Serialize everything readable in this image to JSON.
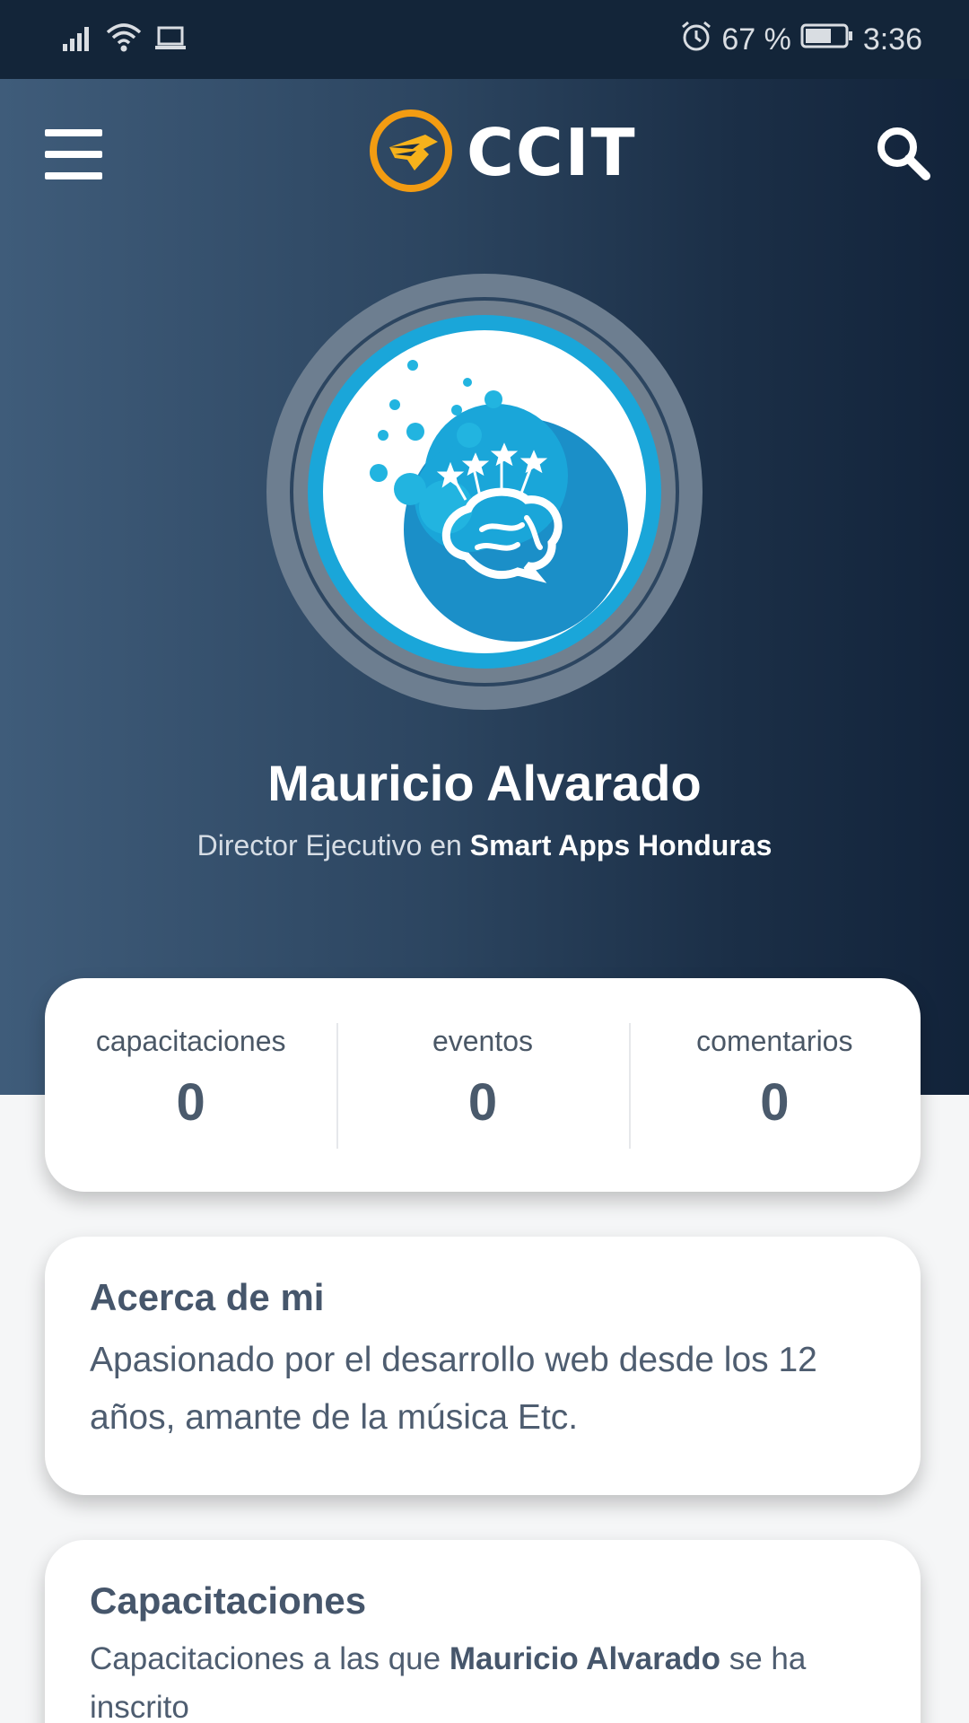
{
  "status_bar": {
    "battery_percent": "67 %",
    "battery_level": 0.67,
    "time": "3:36",
    "icons": [
      "signal-icon",
      "wifi-icon",
      "laptop-icon",
      "alarm-icon",
      "battery-icon"
    ]
  },
  "header": {
    "brand": "CCIT",
    "icons": [
      "menu-icon",
      "logo-icon",
      "search-icon"
    ]
  },
  "profile": {
    "name": "Mauricio Alvarado",
    "role_prefix": "Director Ejecutivo en",
    "company": "Smart Apps Honduras"
  },
  "stats": [
    {
      "label": "capacitaciones",
      "value": "0"
    },
    {
      "label": "eventos",
      "value": "0"
    },
    {
      "label": "comentarios",
      "value": "0"
    }
  ],
  "about": {
    "title": "Acerca de mi",
    "text": "Apasionado por el desarrollo web desde los 12 años, amante de la música Etc."
  },
  "trainings": {
    "title": "Capacitaciones",
    "text_prefix": "Capacitaciones a las que",
    "name": "Mauricio Alvarado",
    "text_suffix": "se ha inscrito"
  },
  "colors": {
    "header_dark": "#132539",
    "hero_light": "#3f5c7a",
    "brand_orange": "#f39c12",
    "avatar_blue": "#1aa6d9",
    "text_slate": "#4a5a6c"
  }
}
